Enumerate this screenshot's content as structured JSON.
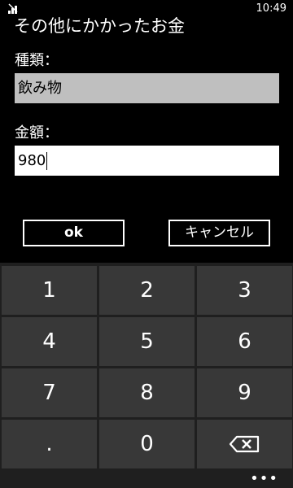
{
  "status_bar": {
    "time": "10:49"
  },
  "dialog": {
    "title": "その他にかかったお金",
    "kind_label": "種類：",
    "kind_value": "飲み物",
    "amount_label": "金額：",
    "amount_value": "980"
  },
  "buttons": {
    "ok": "ok",
    "cancel": "キャンセル"
  },
  "keypad": {
    "keys": [
      "1",
      "2",
      "3",
      "4",
      "5",
      "6",
      "7",
      "8",
      "9",
      ".",
      "0"
    ],
    "backspace_icon": "backspace-icon"
  },
  "app_bar": {
    "more": "•••"
  }
}
